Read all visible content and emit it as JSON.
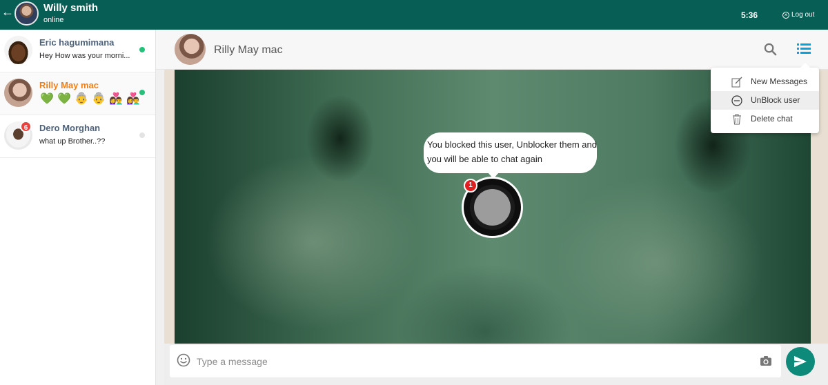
{
  "header": {
    "user_name": "Willy smith",
    "user_status": "online",
    "time": "5:36",
    "logout_label": "Log out",
    "back_icon": "arrow-left-icon"
  },
  "sidebar": {
    "chats": [
      {
        "name": "Eric hagumimana",
        "last_message": "Hey How was your morni...",
        "online": true,
        "status_color": "#25c17a"
      },
      {
        "name": "Rilly May mac",
        "emojis": [
          "💚",
          "💚",
          "👵",
          "👵",
          "👩‍❤️‍👨",
          "👩‍❤️‍👨"
        ],
        "online": true,
        "active": true,
        "status_color": "#25c17a"
      },
      {
        "name": "Dero Morghan",
        "last_message": "what up Brother..??",
        "unread": "6",
        "online": false,
        "status_color": "#e3e3e3"
      }
    ]
  },
  "conversation": {
    "contact_name": "Rilly May mac",
    "blocked_notice": "You blocked this user, Unblocker them and you will be able to chat again",
    "record_badge": "1",
    "input_placeholder": "Type a message"
  },
  "menu": {
    "items": [
      {
        "label": "New Messages",
        "icon": "edit-icon"
      },
      {
        "label": "UnBlock user",
        "icon": "minus-circle-icon"
      },
      {
        "label": "Delete chat",
        "icon": "trash-icon"
      }
    ]
  },
  "colors": {
    "brand": "#075e54",
    "accent_send": "#0e8a7a",
    "menu_icon": "#0aa0d8",
    "active_name": "#f07f16"
  }
}
